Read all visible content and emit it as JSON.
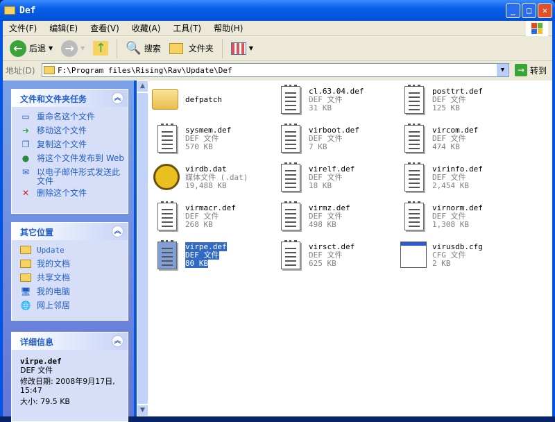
{
  "window": {
    "title": "Def"
  },
  "menu": [
    "文件(F)",
    "编辑(E)",
    "查看(V)",
    "收藏(A)",
    "工具(T)",
    "帮助(H)"
  ],
  "toolbar": {
    "back": "后退",
    "search": "搜索",
    "folders": "文件夹"
  },
  "address": {
    "label": "地址(D)",
    "value": "F:\\Program files\\Rising\\Rav\\Update\\Def",
    "go": "转到"
  },
  "tasks": {
    "title": "文件和文件夹任务",
    "items": [
      "重命名这个文件",
      "移动这个文件",
      "复制这个文件",
      "将这个文件发布到 Web",
      "以电子邮件形式发送此文件",
      "删除这个文件"
    ]
  },
  "places": {
    "title": "其它位置",
    "items": [
      "Update",
      "我的文档",
      "共享文档",
      "我的电脑",
      "网上邻居"
    ]
  },
  "details": {
    "title": "详细信息",
    "name": "virpe.def",
    "type": "DEF 文件",
    "modified": "修改日期: 2008年9月17日, 15:47",
    "size": "大小: 79.5 KB"
  },
  "files": [
    {
      "name": "defpatch",
      "kind": "folder"
    },
    {
      "name": "cl.63.04.def",
      "type": "DEF 文件",
      "size": "31 KB",
      "kind": "doc"
    },
    {
      "name": "posttrt.def",
      "type": "DEF 文件",
      "size": "125 KB",
      "kind": "doc"
    },
    {
      "name": "sysmem.def",
      "type": "DEF 文件",
      "size": "570 KB",
      "kind": "doc"
    },
    {
      "name": "virboot.def",
      "type": "DEF 文件",
      "size": "7 KB",
      "kind": "doc"
    },
    {
      "name": "vircom.def",
      "type": "DEF 文件",
      "size": "474 KB",
      "kind": "doc"
    },
    {
      "name": "virdb.dat",
      "type": "媒体文件 (.dat)",
      "size": "19,488 KB",
      "kind": "vcd"
    },
    {
      "name": "virelf.def",
      "type": "DEF 文件",
      "size": "18 KB",
      "kind": "doc"
    },
    {
      "name": "virinfo.def",
      "type": "DEF 文件",
      "size": "2,454 KB",
      "kind": "doc"
    },
    {
      "name": "virmacr.def",
      "type": "DEF 文件",
      "size": "268 KB",
      "kind": "doc"
    },
    {
      "name": "virmz.def",
      "type": "DEF 文件",
      "size": "498 KB",
      "kind": "doc"
    },
    {
      "name": "virnorm.def",
      "type": "DEF 文件",
      "size": "1,308 KB",
      "kind": "doc"
    },
    {
      "name": "virpe.def",
      "type": "DEF 文件",
      "size": "80 KB",
      "kind": "doc",
      "selected": true
    },
    {
      "name": "virsct.def",
      "type": "DEF 文件",
      "size": "625 KB",
      "kind": "doc"
    },
    {
      "name": "virusdb.cfg",
      "type": "CFG 文件",
      "size": "2 KB",
      "kind": "cfg"
    }
  ]
}
